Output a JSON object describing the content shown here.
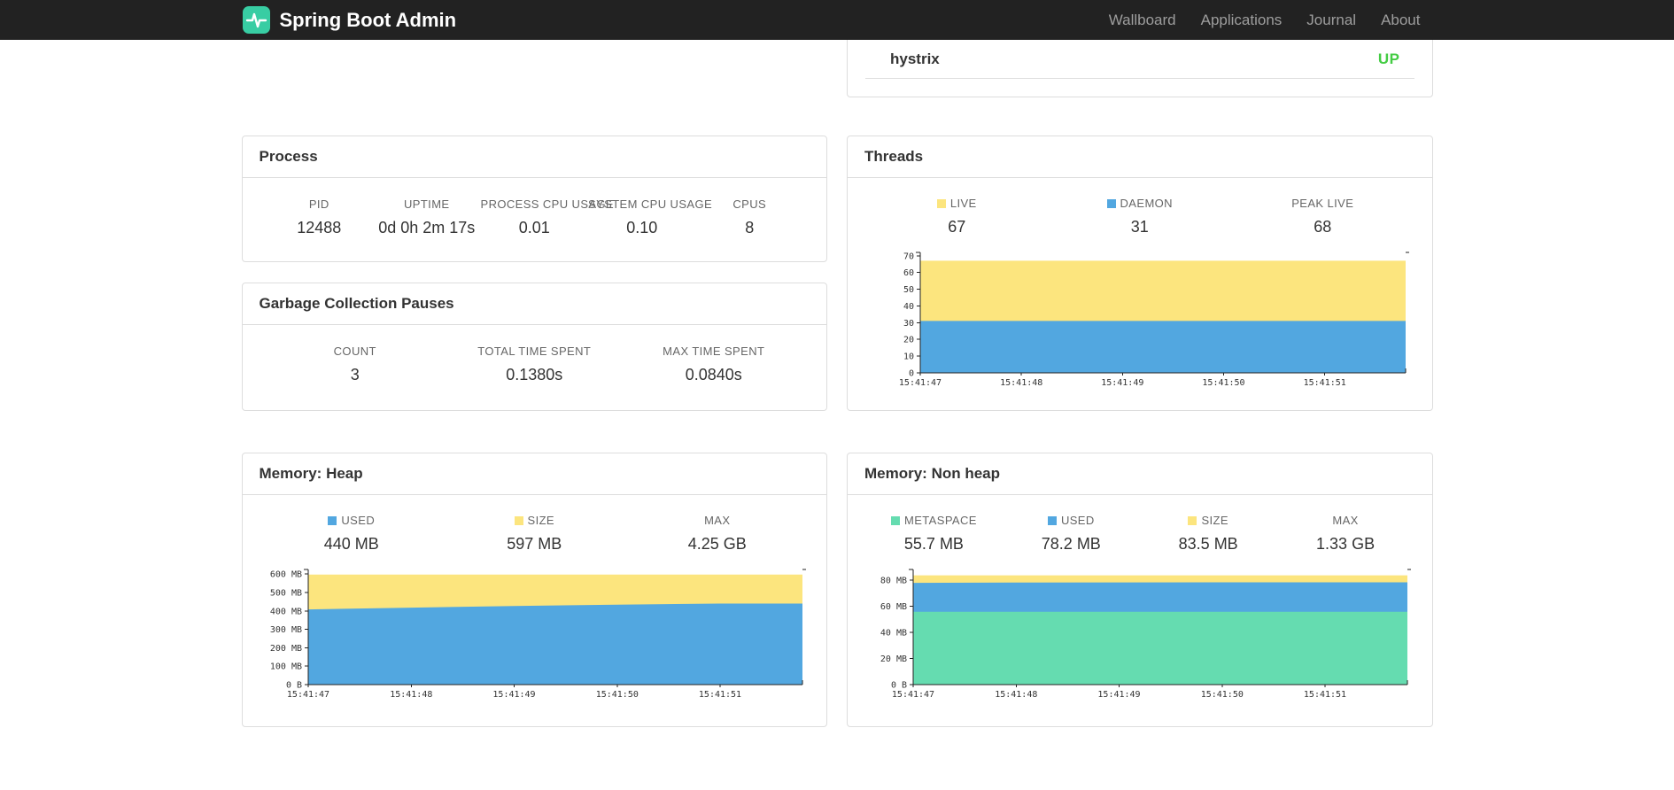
{
  "colors": {
    "navbar_bg": "#222222",
    "brand_logo": "#38cda3",
    "status_up": "#44cc44",
    "chart_blue": "#52a7e0",
    "chart_yellow": "#fce57e",
    "chart_green": "#65dcb0"
  },
  "navbar": {
    "brand": "Spring Boot Admin",
    "links": [
      {
        "label": "Wallboard"
      },
      {
        "label": "Applications"
      },
      {
        "label": "Journal"
      },
      {
        "label": "About"
      }
    ]
  },
  "application_row": {
    "name": "hystrix",
    "status": "UP"
  },
  "panels": {
    "process": {
      "title": "Process",
      "stats": [
        {
          "label": "PID",
          "value": "12488"
        },
        {
          "label": "UPTIME",
          "value": "0d 0h 2m 17s"
        },
        {
          "label": "PROCESS CPU USAGE",
          "value": "0.01"
        },
        {
          "label": "SYSTEM CPU USAGE",
          "value": "0.10"
        },
        {
          "label": "CPUS",
          "value": "8"
        }
      ]
    },
    "gc": {
      "title": "Garbage Collection Pauses",
      "stats": [
        {
          "label": "COUNT",
          "value": "3"
        },
        {
          "label": "TOTAL TIME SPENT",
          "value": "0.1380s"
        },
        {
          "label": "MAX TIME SPENT",
          "value": "0.0840s"
        }
      ]
    },
    "threads": {
      "title": "Threads",
      "stats": [
        {
          "label": "LIVE",
          "value": "67",
          "swatch": "#fce57e"
        },
        {
          "label": "DAEMON",
          "value": "31",
          "swatch": "#52a7e0"
        },
        {
          "label": "PEAK LIVE",
          "value": "68"
        }
      ]
    },
    "heap": {
      "title": "Memory: Heap",
      "stats": [
        {
          "label": "USED",
          "value": "440 MB",
          "swatch": "#52a7e0"
        },
        {
          "label": "SIZE",
          "value": "597 MB",
          "swatch": "#fce57e"
        },
        {
          "label": "MAX",
          "value": "4.25 GB"
        }
      ]
    },
    "nonheap": {
      "title": "Memory: Non heap",
      "stats": [
        {
          "label": "METASPACE",
          "value": "55.7 MB",
          "swatch": "#65dcb0"
        },
        {
          "label": "USED",
          "value": "78.2 MB",
          "swatch": "#52a7e0"
        },
        {
          "label": "SIZE",
          "value": "83.5 MB",
          "swatch": "#fce57e"
        },
        {
          "label": "MAX",
          "value": "1.33 GB"
        }
      ]
    }
  },
  "chart_data": [
    {
      "id": "threads",
      "type": "area",
      "title": "Threads",
      "x": [
        "15:41:47",
        "15:41:48",
        "15:41:49",
        "15:41:50",
        "15:41:51"
      ],
      "x_extend": 0.8,
      "ylim": [
        0,
        72
      ],
      "ytick_values": [
        0,
        10,
        20,
        30,
        40,
        50,
        60,
        70
      ],
      "ytick_labels": [
        "0",
        "10",
        "20",
        "30",
        "40",
        "50",
        "60",
        "70"
      ],
      "series": [
        {
          "name": "DAEMON",
          "color": "#52a7e0",
          "values": [
            31,
            31,
            31,
            31,
            31
          ]
        },
        {
          "name": "LIVE",
          "color": "#fce57e",
          "values": [
            67,
            67,
            67,
            67,
            67
          ]
        }
      ],
      "legend_position": "top",
      "grid": false
    },
    {
      "id": "memory-heap",
      "type": "area",
      "title": "Memory: Heap",
      "x": [
        "15:41:47",
        "15:41:48",
        "15:41:49",
        "15:41:50",
        "15:41:51"
      ],
      "x_extend": 0.8,
      "ylim": [
        0,
        625
      ],
      "ytick_values": [
        0,
        100,
        200,
        300,
        400,
        500,
        600
      ],
      "ytick_labels": [
        "0 B",
        "100 MB",
        "200 MB",
        "300 MB",
        "400 MB",
        "500 MB",
        "600 MB"
      ],
      "series": [
        {
          "name": "USED",
          "color": "#52a7e0",
          "values": [
            408,
            418,
            427,
            434,
            440
          ]
        },
        {
          "name": "SIZE",
          "color": "#fce57e",
          "values": [
            597,
            597,
            597,
            597,
            597
          ]
        }
      ],
      "legend_position": "top",
      "grid": false
    },
    {
      "id": "memory-nonheap",
      "type": "area",
      "title": "Memory: Non heap",
      "x": [
        "15:41:47",
        "15:41:48",
        "15:41:49",
        "15:41:50",
        "15:41:51"
      ],
      "x_extend": 0.8,
      "ylim": [
        0,
        88
      ],
      "ytick_values": [
        0,
        20,
        40,
        60,
        80
      ],
      "ytick_labels": [
        "0 B",
        "20 MB",
        "40 MB",
        "60 MB",
        "80 MB"
      ],
      "series": [
        {
          "name": "METASPACE",
          "color": "#65dcb0",
          "values": [
            55.7,
            55.7,
            55.7,
            55.7,
            55.7
          ]
        },
        {
          "name": "USED",
          "color": "#52a7e0",
          "values": [
            77.8,
            78.0,
            78.1,
            78.2,
            78.2
          ]
        },
        {
          "name": "SIZE",
          "color": "#fce57e",
          "values": [
            83.5,
            83.5,
            83.5,
            83.5,
            83.5
          ]
        }
      ],
      "legend_position": "top",
      "grid": false
    }
  ]
}
